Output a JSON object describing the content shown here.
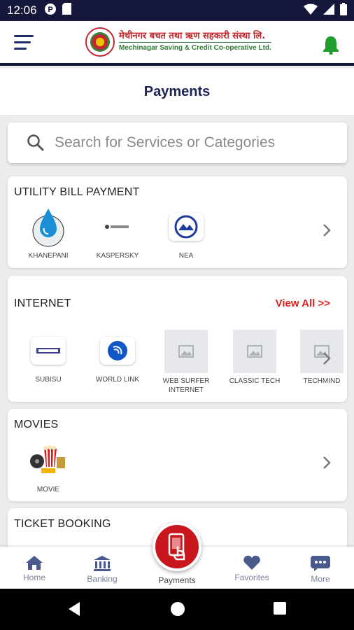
{
  "status_bar": {
    "time": "12:06"
  },
  "header": {
    "org_name_np": "मेचीनगर बचत तथा ऋण सहकारी संस्था लि.",
    "org_name_en": "Mechinagar Saving & Credit Co-operative Ltd."
  },
  "page": {
    "title": "Payments"
  },
  "search": {
    "placeholder": "Search for Services or Categories"
  },
  "sections": {
    "utility": {
      "title": "UTILITY BILL PAYMENT",
      "items": [
        {
          "label": "KHANEPANI",
          "icon": "water-drop-icon"
        },
        {
          "label": "KASPERSKY",
          "icon": "kaspersky-logo-icon"
        },
        {
          "label": "NEA",
          "icon": "nea-logo-icon"
        }
      ]
    },
    "internet": {
      "title": "INTERNET",
      "view_all": "View All >>",
      "items": [
        {
          "label": "SUBISU",
          "icon": "subisu-logo-icon"
        },
        {
          "label": "WORLD LINK",
          "icon": "worldlink-logo-icon"
        },
        {
          "label": "WEB SURFER INTERNET",
          "icon": "image-placeholder-icon"
        },
        {
          "label": "CLASSIC TECH",
          "icon": "image-placeholder-icon"
        },
        {
          "label": "TECHMIND",
          "icon": "image-placeholder-icon"
        }
      ]
    },
    "movies": {
      "title": "MOVIES",
      "items": [
        {
          "label": "MOVIE",
          "icon": "movie-icon"
        }
      ]
    },
    "ticket": {
      "title": "TICKET BOOKING"
    }
  },
  "bottom_nav": {
    "home": "Home",
    "banking": "Banking",
    "payments": "Payments",
    "favorites": "Favorites",
    "more": "More"
  },
  "colors": {
    "primary_dark": "#14163a",
    "accent_red": "#c8161c",
    "view_all_red": "#e0201f",
    "nav_grey": "#7c8198",
    "bell_green": "#1e9e2e"
  }
}
